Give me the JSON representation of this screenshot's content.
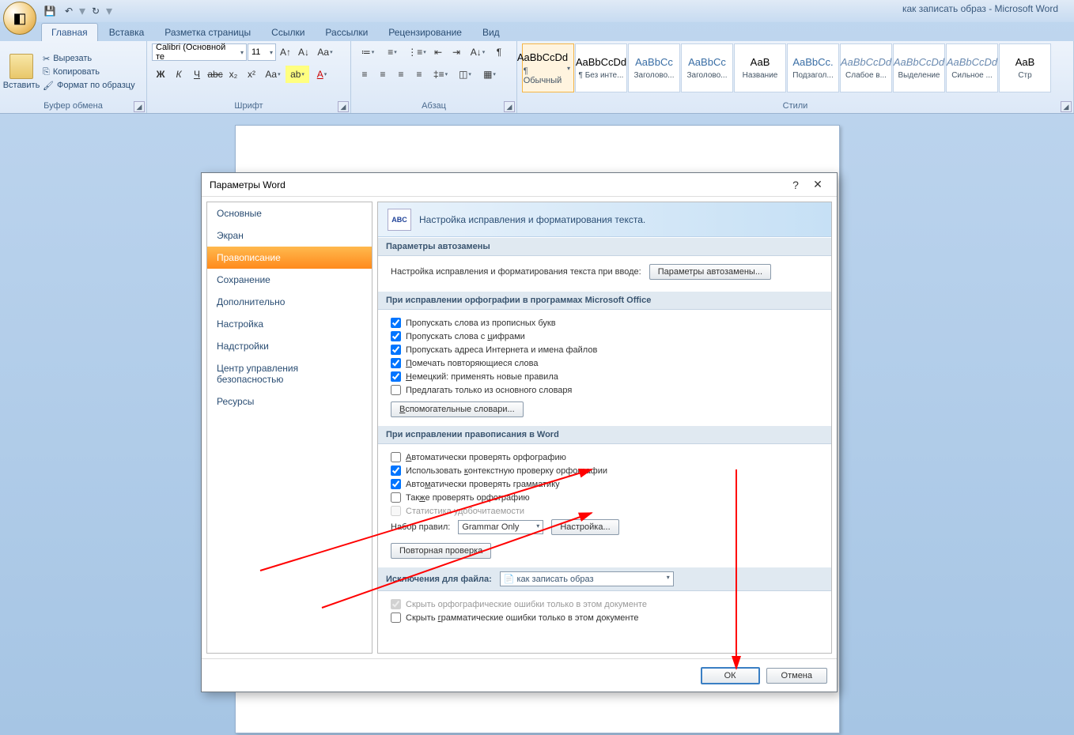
{
  "title": "как записать образ - Microsoft Word",
  "tabs": [
    "Главная",
    "Вставка",
    "Разметка страницы",
    "Ссылки",
    "Рассылки",
    "Рецензирование",
    "Вид"
  ],
  "clipboard": {
    "paste": "Вставить",
    "cut": "Вырезать",
    "copy": "Копировать",
    "fmt": "Формат по образцу",
    "label": "Буфер обмена"
  },
  "font": {
    "name": "Calibri (Основной те",
    "size": "11",
    "label": "Шрифт"
  },
  "para": {
    "label": "Абзац"
  },
  "styles": {
    "label": "Стили",
    "items": [
      {
        "sample": "AaBbCcDd",
        "name": "¶ Обычный",
        "sel": true
      },
      {
        "sample": "AaBbCcDd",
        "name": "¶ Без инте..."
      },
      {
        "sample": "AaBbCc",
        "name": "Заголово..."
      },
      {
        "sample": "AaBbCc",
        "name": "Заголово..."
      },
      {
        "sample": "АаВ",
        "name": "Название"
      },
      {
        "sample": "AaBbCc.",
        "name": "Подзагол..."
      },
      {
        "sample": "AaBbCcDd",
        "name": "Слабое в..."
      },
      {
        "sample": "AaBbCcDd",
        "name": "Выделение"
      },
      {
        "sample": "AaBbCcDd",
        "name": "Сильное ..."
      },
      {
        "sample": "AaB",
        "name": "Стр"
      }
    ]
  },
  "dialog": {
    "title": "Параметры Word",
    "nav": [
      "Основные",
      "Экран",
      "Правописание",
      "Сохранение",
      "Дополнительно",
      "Настройка",
      "Надстройки",
      "Центр управления безопасностью",
      "Ресурсы"
    ],
    "headerText": "Настройка исправления и форматирования текста.",
    "s1": {
      "title": "Параметры автозамены",
      "desc": "Настройка исправления и форматирования текста при вводе:",
      "btn": "Параметры автозамены..."
    },
    "s2": {
      "title": "При исправлении орфографии в программах Microsoft Office",
      "c1": "Пропускать слова из прописных букв",
      "c2": "Пропускать слова с цифрами",
      "c3": "Пропускать адреса Интернета и имена файлов",
      "c4": "Помечать повторяющиеся слова",
      "c5": "Немецкий: применять новые правила",
      "c6": "Предлагать только из основного словаря",
      "btn": "Вспомогательные словари..."
    },
    "s3": {
      "title": "При исправлении правописания в Word",
      "c1": "Автоматически проверять орфографию",
      "c2": "Использовать контекстную проверку орфографии",
      "c3": "Автоматически проверять грамматику",
      "c4": "Также проверять орфографию",
      "c5": "Статистика удобочитаемости",
      "ruleLabel": "Набор правил:",
      "ruleVal": "Grammar Only",
      "cfg": "Настройка...",
      "recheck": "Повторная проверка"
    },
    "s4": {
      "title": "Исключения для файла:",
      "file": "как записать образ",
      "c1": "Скрыть орфографические ошибки только в этом документе",
      "c2": "Скрыть грамматические ошибки только в этом документе"
    },
    "ok": "ОК",
    "cancel": "Отмена"
  }
}
